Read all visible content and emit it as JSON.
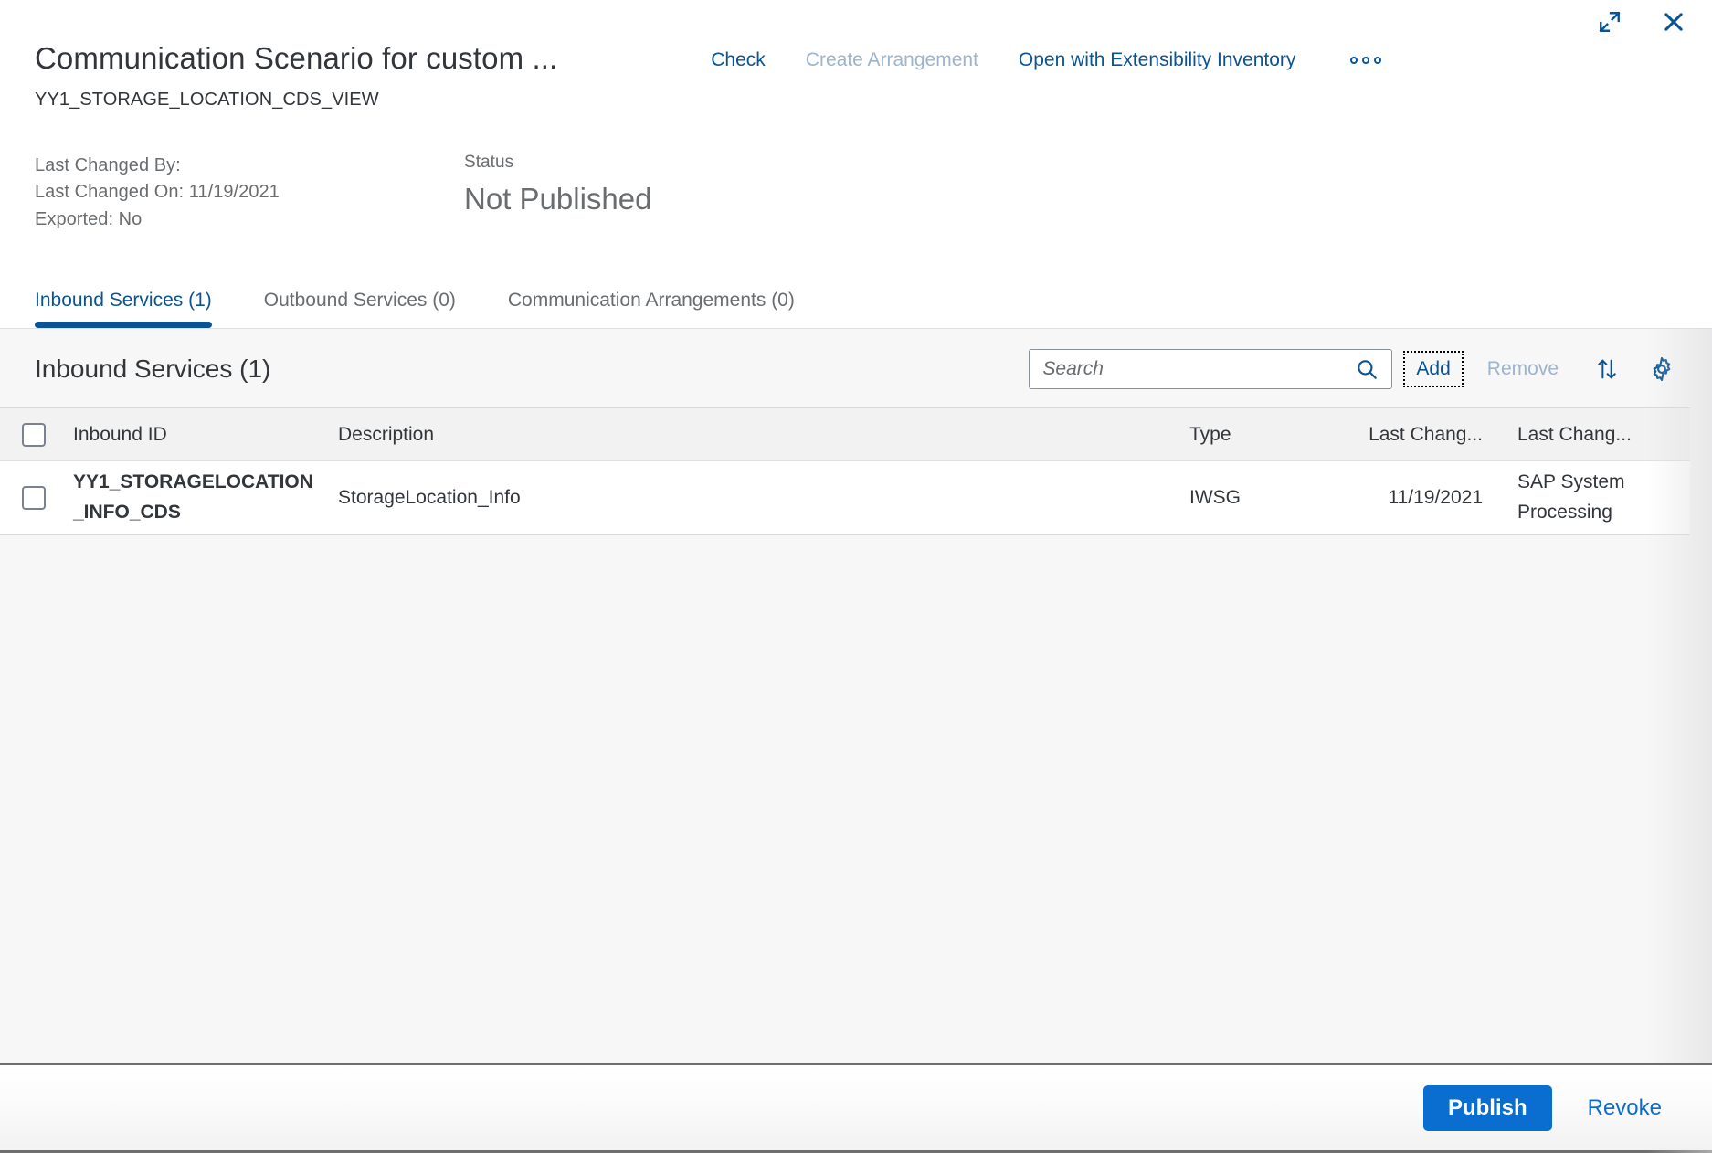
{
  "window": {
    "maximize_icon": "maximize-icon",
    "close_icon": "close-icon",
    "overflow_icon": "overflow-menu-icon"
  },
  "header": {
    "title": "Communication Scenario for custom ...",
    "subtitle": "YY1_STORAGE_LOCATION_CDS_VIEW",
    "actions": [
      {
        "label": "Check",
        "disabled": false
      },
      {
        "label": "Create Arrangement",
        "disabled": true
      },
      {
        "label": "Open with Extensibility Inventory",
        "disabled": false
      }
    ]
  },
  "meta": {
    "last_changed_by": "Last Changed By:",
    "last_changed_on": "Last Changed On: 11/19/2021",
    "exported": "Exported: No",
    "status_label": "Status",
    "status_value": "Not Published"
  },
  "tabs": [
    {
      "label": "Inbound Services (1)",
      "active": true
    },
    {
      "label": "Outbound Services (0)",
      "active": false
    },
    {
      "label": "Communication Arrangements (0)",
      "active": false
    }
  ],
  "toolbar": {
    "title": "Inbound Services (1)",
    "search_placeholder": "Search",
    "search_value": "",
    "search_icon": "search-icon",
    "add_label": "Add",
    "remove_label": "Remove",
    "sort_icon": "sort-icon",
    "settings_icon": "gear-icon"
  },
  "table": {
    "columns": [
      "Inbound ID",
      "Description",
      "Type",
      "Last Chang...",
      "Last Chang..."
    ],
    "rows": [
      {
        "inbound_id": "YY1_STORAGELOCATION_INFO_CDS",
        "description": "StorageLocation_Info",
        "type": "IWSG",
        "last_changed_on": "11/19/2021",
        "last_changed_by": "SAP System Processing",
        "selected": false
      }
    ]
  },
  "footer": {
    "publish_label": "Publish",
    "revoke_label": "Revoke"
  },
  "colors": {
    "accent": "#0a6ed1",
    "link": "#0a5495",
    "disabled_link": "#9db4ce",
    "text": "#32363a",
    "muted": "#6a6d70",
    "bg": "#f7f7f7"
  }
}
